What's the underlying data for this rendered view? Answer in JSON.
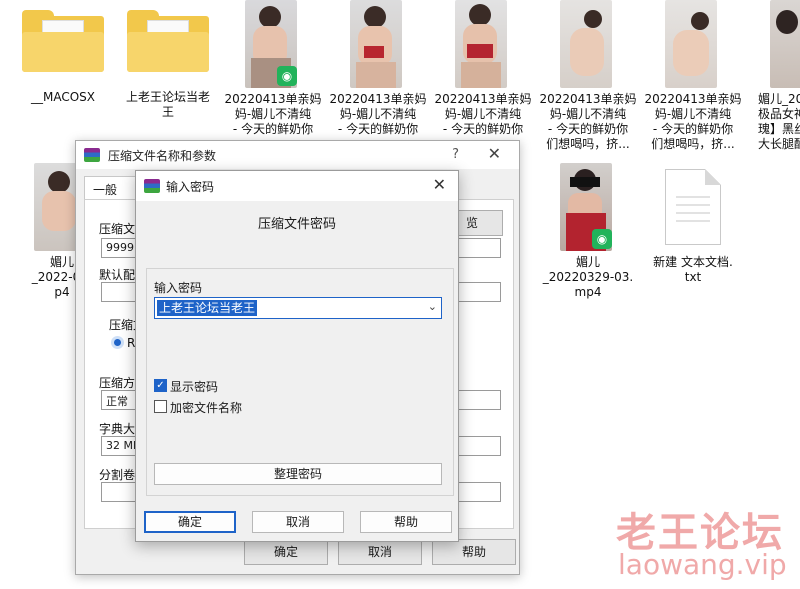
{
  "desktop": {
    "folders": [
      {
        "name": "__MACOSX"
      },
      {
        "name": "上老王论坛当老\n王"
      }
    ],
    "top_files": [
      {
        "name": "20220413单亲妈\n妈-媚儿不清纯\n- 今天的鲜奶你"
      },
      {
        "name": "20220413单亲妈\n妈-媚儿不清纯\n- 今天的鲜奶你"
      },
      {
        "name": "20220413单亲妈\n妈-媚儿不清纯\n- 今天的鲜奶你"
      },
      {
        "name": "20220413单亲妈\n妈-媚儿不清纯\n- 今天的鲜奶你\n们想喝吗，挤..."
      },
      {
        "name": "20220413单亲妈\n妈-媚儿不清纯\n- 今天的鲜奶你\n们想喝吗，挤..."
      },
      {
        "name": "媚儿_20\n极品女神\n瑰】黑丝\n大长腿酷"
      }
    ],
    "row2_files": [
      {
        "name": "媚儿\n_2022-04-\np4"
      },
      {
        "name": "媚儿\n_20220329-03.\nmp4"
      },
      {
        "name": "新建 文本文档.\ntxt"
      }
    ]
  },
  "back_dialog": {
    "title": "压缩文件名称和参数",
    "help_glyph": "?",
    "close_glyph": "✕",
    "tab_general": "一般",
    "label_archive_name": "压缩文",
    "archive_name_value": "9999.r",
    "label_default_profile": "默认配",
    "label_archive_format": "压缩文",
    "radio_rar": "RA",
    "label_compression_method": "压缩方",
    "compression_method_value": "正常",
    "label_dictionary": "字典大",
    "dictionary_value": "32 MB",
    "label_split": "分割卷",
    "browse_button": "览",
    "ok_button": "确定",
    "cancel_button": "取消",
    "help_button": "帮助"
  },
  "password_dialog": {
    "title": "输入密码",
    "close_glyph": "✕",
    "heading": "压缩文件密码",
    "password_label": "输入密码",
    "password_value": "上老王论坛当老王",
    "show_password_label": "显示密码",
    "show_password_checked": true,
    "encrypt_names_label": "加密文件名称",
    "encrypt_names_checked": false,
    "organize_button": "整理密码",
    "ok_button": "确定",
    "cancel_button": "取消",
    "help_button": "帮助"
  },
  "watermark": {
    "line1": "老王论坛",
    "line2": "laowang.vip"
  },
  "colors": {
    "accent": "#1e63c8",
    "folder": "#f2c84b",
    "wechat_badge": "#22b35b",
    "watermark": "#f0a9a9"
  }
}
